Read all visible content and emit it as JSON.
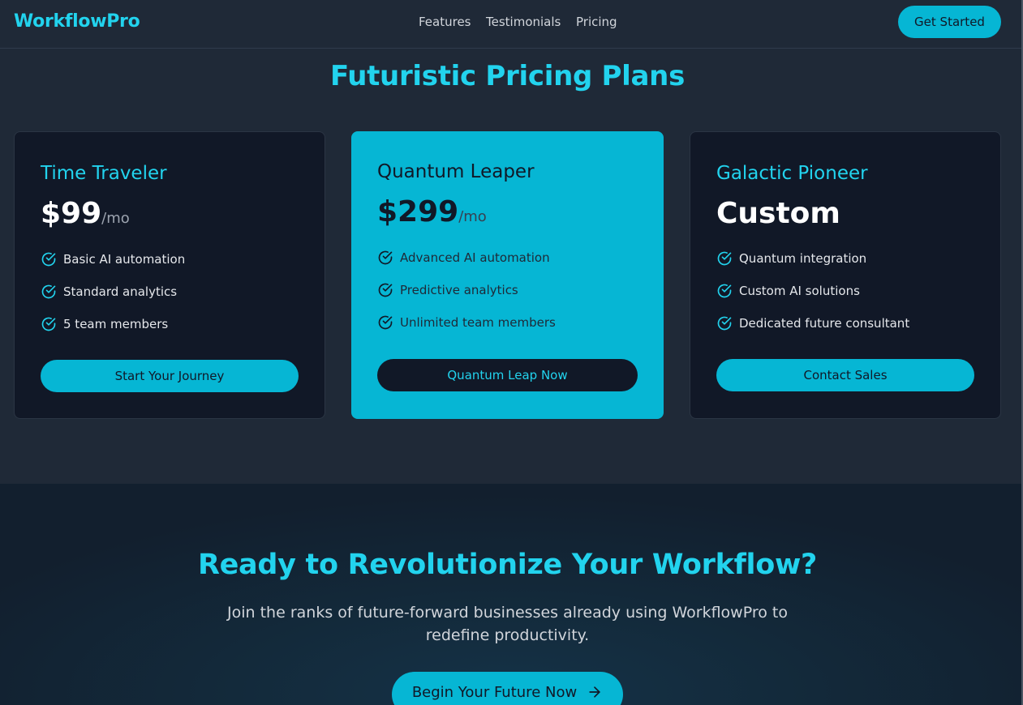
{
  "nav": {
    "logo": "WorkflowPro",
    "links": [
      "Features",
      "Testimonials",
      "Pricing"
    ],
    "cta_label": "Get Started"
  },
  "pricing": {
    "title": "Futuristic Pricing Plans",
    "plans": [
      {
        "name": "Time Traveler",
        "price": "$99",
        "period": "/mo",
        "features": [
          "Basic AI automation",
          "Standard analytics",
          "5 team members"
        ],
        "button_label": "Start Your Journey",
        "highlighted": false
      },
      {
        "name": "Quantum Leaper",
        "price": "$299",
        "period": "/mo",
        "features": [
          "Advanced AI automation",
          "Predictive analytics",
          "Unlimited team members"
        ],
        "button_label": "Quantum Leap Now",
        "highlighted": true
      },
      {
        "name": "Galactic Pioneer",
        "price": "Custom",
        "period": "",
        "features": [
          "Quantum integration",
          "Custom AI solutions",
          "Dedicated future consultant"
        ],
        "button_label": "Contact Sales",
        "highlighted": false
      }
    ]
  },
  "cta": {
    "title": "Ready to Revolutionize Your Workflow?",
    "text": "Join the ranks of future-forward businesses already using WorkflowPro to redefine productivity.",
    "button_label": "Begin Your Future Now",
    "button_icon": "arrow-right-icon"
  },
  "colors": {
    "accent": "#06b6d4",
    "accent_text": "#22d3ee",
    "background": "#1f2937",
    "card_dark": "#111827"
  }
}
